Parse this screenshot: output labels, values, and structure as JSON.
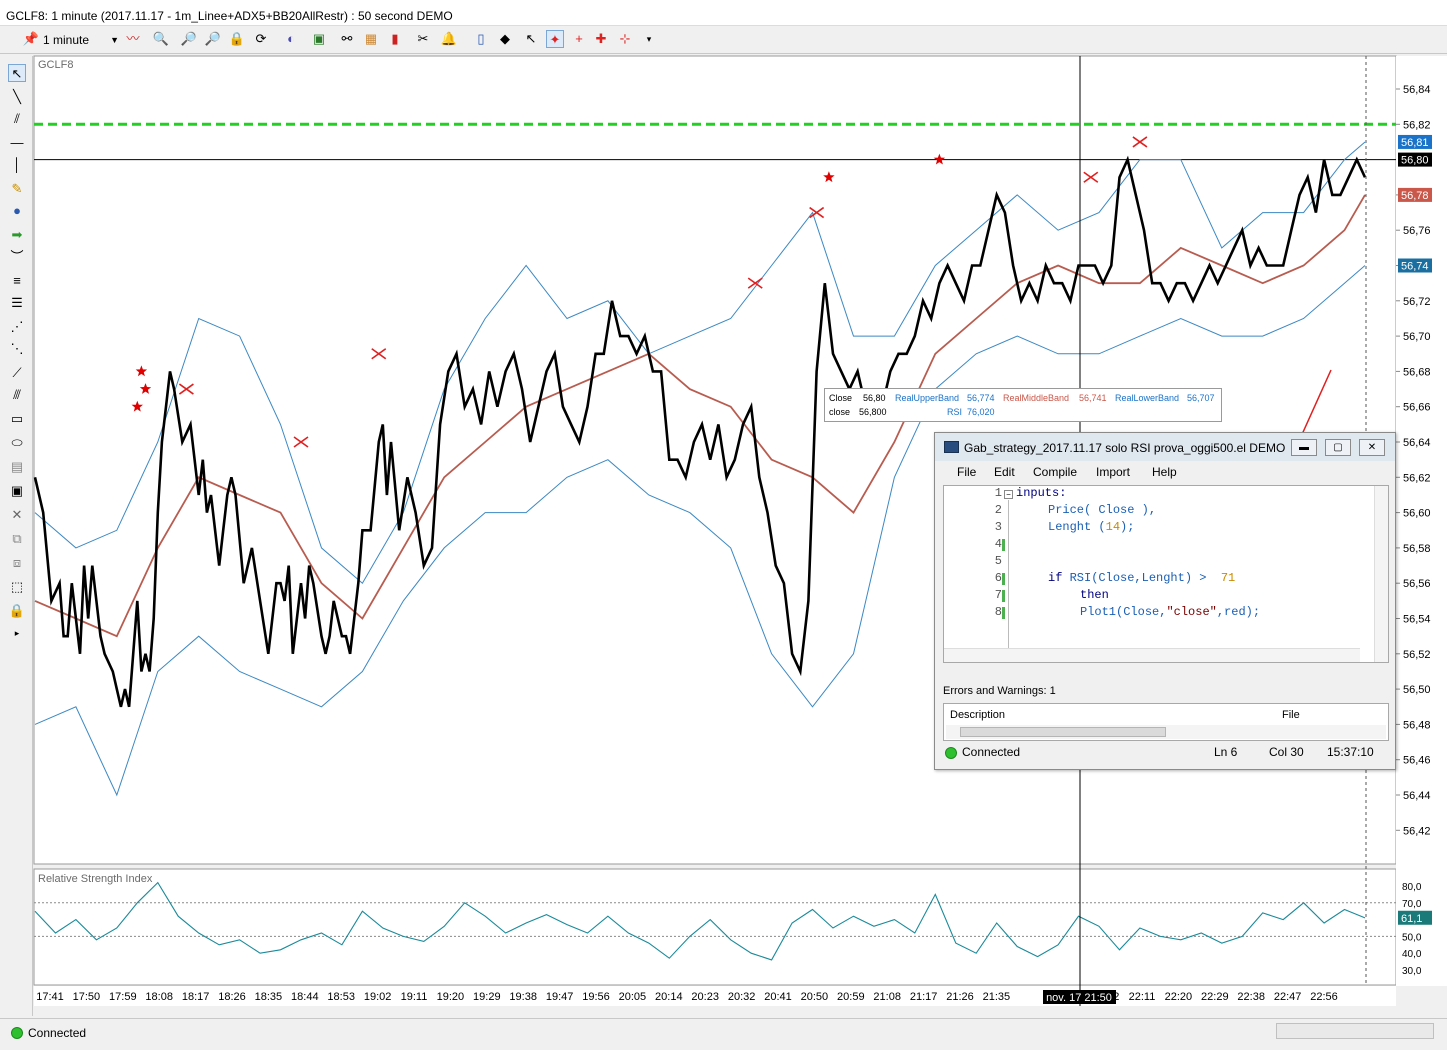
{
  "window": {
    "title": "GCLF8: 1 minute (2017.11.17 - 1m_Linee+ADX5+BB20AllRestr) : 50 second DEMO"
  },
  "toolbar": {
    "interval": "1 minute"
  },
  "chart_data": [
    {
      "type": "line",
      "title": "GCLF8",
      "x_unit": "minutes since 17:41 (10.38 minutes per time tick)",
      "xlim": [
        0,
        325
      ],
      "ylim": [
        56.4,
        56.86
      ],
      "yticks": [
        "56,84",
        "56,82",
        "56,78",
        "56,76",
        "56,74",
        "56,72",
        "56,70",
        "56,68",
        "56,66",
        "56,64",
        "56,62",
        "56,60",
        "56,58",
        "56,56",
        "56,54",
        "56,52",
        "56,50",
        "56,48",
        "56,46",
        "56,44",
        "56,42"
      ],
      "xtick_labels": [
        "17:41",
        "17:50",
        "17:59",
        "18:08",
        "18:17",
        "18:26",
        "18:35",
        "18:44",
        "18:53",
        "19:02",
        "19:11",
        "19:20",
        "19:29",
        "19:38",
        "19:47",
        "19:56",
        "20:05",
        "20:14",
        "20:23",
        "20:32",
        "20:41",
        "20:50",
        "20:59",
        "21:08",
        "21:17",
        "21:26",
        "21:35",
        "22:02",
        "22:11",
        "22:20",
        "22:29",
        "22:38",
        "22:47",
        "22:56"
      ],
      "crosshair_time_label": "nov. 17 21:50",
      "crosshair_price_label": "56,80",
      "price_badges": [
        {
          "value": "56,81",
          "color": "#1a73c9"
        },
        {
          "value": "56,80",
          "color": "#000000"
        },
        {
          "value": "56,78",
          "color": "#c9574a"
        },
        {
          "value": "56,74",
          "color": "#1a6fa0"
        }
      ],
      "hline_green": 56.82,
      "grid": false,
      "series": [
        {
          "name": "Close",
          "color": "#000000",
          "x": [
            0,
            2,
            4,
            6,
            7,
            8,
            9,
            11,
            12,
            13,
            14,
            16,
            17,
            19,
            20,
            21,
            22,
            23,
            24,
            25,
            26,
            27,
            28,
            29,
            30,
            31,
            32,
            33,
            34,
            36,
            38,
            39,
            40,
            41,
            42,
            43,
            44,
            45,
            46,
            47,
            48,
            49,
            51,
            53,
            55,
            57,
            59,
            60,
            61,
            62,
            63,
            65,
            66,
            67,
            68,
            70,
            71,
            72,
            73,
            74,
            75,
            76,
            77,
            78,
            79,
            80,
            82,
            84,
            85,
            86,
            87,
            89,
            91,
            93,
            95,
            97,
            99,
            101,
            103,
            105,
            107,
            109,
            111,
            113,
            115,
            117,
            119,
            121,
            123,
            125,
            127,
            129,
            131,
            133,
            135,
            137,
            139,
            141,
            143,
            145,
            147,
            149,
            151,
            153,
            155,
            157,
            159,
            161,
            163,
            165,
            167,
            169,
            171,
            173,
            175,
            177,
            179,
            181,
            183,
            185,
            187,
            189,
            191,
            193,
            195,
            197,
            199,
            201,
            203,
            205,
            207,
            209,
            211,
            213,
            215,
            217,
            219,
            221,
            223,
            225,
            227,
            229,
            231,
            233,
            235,
            237,
            239,
            241,
            243,
            245,
            247,
            249,
            251,
            253,
            255,
            257,
            259,
            261,
            263,
            265,
            267,
            269,
            271,
            273,
            275,
            277,
            279,
            281,
            283,
            285,
            287,
            289,
            291,
            293,
            295,
            297,
            299,
            301,
            303,
            305,
            307,
            309,
            311,
            313,
            315,
            317,
            319,
            321,
            323,
            325
          ],
          "y": [
            56.62,
            56.6,
            56.55,
            56.56,
            56.53,
            56.53,
            56.56,
            56.52,
            56.57,
            56.54,
            56.57,
            56.53,
            56.52,
            56.51,
            56.5,
            56.49,
            56.5,
            56.49,
            56.52,
            56.55,
            56.51,
            56.52,
            56.51,
            56.54,
            56.6,
            56.64,
            56.66,
            56.68,
            56.67,
            56.64,
            56.65,
            56.63,
            56.61,
            56.63,
            56.6,
            56.61,
            56.59,
            56.57,
            56.59,
            56.61,
            56.62,
            56.61,
            56.56,
            56.58,
            56.55,
            56.52,
            56.56,
            56.56,
            56.55,
            56.57,
            56.52,
            56.56,
            56.54,
            56.57,
            56.56,
            56.53,
            56.52,
            56.53,
            56.55,
            56.54,
            56.53,
            56.53,
            56.52,
            56.54,
            56.56,
            56.59,
            56.59,
            56.64,
            56.65,
            56.61,
            56.64,
            56.59,
            56.62,
            56.6,
            56.57,
            56.58,
            56.65,
            56.68,
            56.69,
            56.66,
            56.67,
            56.65,
            56.68,
            56.66,
            56.68,
            56.69,
            56.67,
            56.64,
            56.66,
            56.68,
            56.69,
            56.66,
            56.65,
            56.64,
            56.66,
            56.69,
            56.69,
            56.72,
            56.7,
            56.7,
            56.69,
            56.7,
            56.68,
            56.68,
            56.63,
            56.63,
            56.62,
            56.64,
            56.65,
            56.63,
            56.65,
            56.62,
            56.63,
            56.65,
            56.66,
            56.62,
            56.6,
            56.57,
            56.56,
            56.52,
            56.51,
            56.55,
            56.68,
            56.73,
            56.69,
            56.68,
            56.67,
            56.68,
            56.66,
            56.66,
            56.66,
            56.68,
            56.69,
            56.69,
            56.7,
            56.72,
            56.71,
            56.73,
            56.74,
            56.73,
            56.72,
            56.74,
            56.74,
            56.76,
            56.78,
            56.77,
            56.74,
            56.72,
            56.73,
            56.72,
            56.74,
            56.73,
            56.73,
            56.72,
            56.74,
            56.74,
            56.74,
            56.73,
            56.74,
            56.79,
            56.8,
            56.78,
            56.76,
            56.73,
            56.73,
            56.72,
            56.73,
            56.73,
            56.72,
            56.73,
            56.74,
            56.73,
            56.74,
            56.75,
            56.76,
            56.74,
            56.75,
            56.74,
            56.74,
            56.74,
            56.76,
            56.78,
            56.79,
            56.77,
            56.8,
            56.78,
            56.78,
            56.79,
            56.8,
            56.79
          ]
        },
        {
          "name": "RealUpperBand",
          "color": "#3b88c3",
          "x": [
            0,
            10,
            20,
            30,
            40,
            50,
            60,
            70,
            80,
            90,
            100,
            110,
            120,
            130,
            140,
            150,
            160,
            170,
            180,
            190,
            200,
            210,
            220,
            230,
            240,
            250,
            260,
            270,
            280,
            290,
            300,
            310,
            320,
            325
          ],
          "y": [
            56.6,
            56.58,
            56.59,
            56.64,
            56.71,
            56.7,
            56.65,
            56.58,
            56.56,
            56.6,
            56.67,
            56.71,
            56.74,
            56.71,
            56.72,
            56.69,
            56.7,
            56.71,
            56.74,
            56.77,
            56.7,
            56.7,
            56.74,
            56.76,
            56.78,
            56.76,
            56.77,
            56.8,
            56.8,
            56.75,
            56.77,
            56.77,
            56.8,
            56.81
          ]
        },
        {
          "name": "RealMiddleBand",
          "color": "#b85c50",
          "x": [
            0,
            10,
            20,
            30,
            40,
            50,
            60,
            70,
            80,
            90,
            100,
            110,
            120,
            130,
            140,
            150,
            160,
            170,
            180,
            190,
            200,
            210,
            220,
            230,
            240,
            250,
            260,
            270,
            280,
            290,
            300,
            310,
            320,
            325
          ],
          "y": [
            56.55,
            56.54,
            56.53,
            56.58,
            56.62,
            56.61,
            56.6,
            56.56,
            56.54,
            56.58,
            56.62,
            56.64,
            56.66,
            56.67,
            56.68,
            56.69,
            56.67,
            56.66,
            56.63,
            56.62,
            56.6,
            56.64,
            56.69,
            56.71,
            56.73,
            56.74,
            56.73,
            56.73,
            56.75,
            56.74,
            56.73,
            56.74,
            56.76,
            56.78
          ]
        },
        {
          "name": "RealLowerBand",
          "color": "#3b88c3",
          "x": [
            0,
            10,
            20,
            30,
            40,
            50,
            60,
            70,
            80,
            90,
            100,
            110,
            120,
            130,
            140,
            150,
            160,
            170,
            180,
            190,
            200,
            210,
            220,
            230,
            240,
            250,
            260,
            270,
            280,
            290,
            300,
            310,
            320,
            325
          ],
          "y": [
            56.48,
            56.49,
            56.44,
            56.51,
            56.53,
            56.51,
            56.5,
            56.49,
            56.51,
            56.55,
            56.58,
            56.6,
            56.6,
            56.62,
            56.63,
            56.61,
            56.6,
            56.58,
            56.52,
            56.49,
            56.52,
            56.62,
            56.67,
            56.69,
            56.7,
            56.69,
            56.69,
            56.7,
            56.71,
            56.7,
            56.7,
            56.71,
            56.73,
            56.74
          ]
        }
      ],
      "markers": {
        "red_x": [
          [
            37,
            56.67
          ],
          [
            65,
            56.64
          ],
          [
            84,
            56.69
          ],
          [
            176,
            56.73
          ],
          [
            191,
            56.77
          ],
          [
            258,
            56.79
          ],
          [
            270,
            56.81
          ]
        ],
        "red_star": [
          [
            25,
            56.66
          ],
          [
            26,
            56.68
          ],
          [
            27,
            56.67
          ],
          [
            194,
            56.79
          ],
          [
            221,
            56.8
          ]
        ]
      }
    },
    {
      "type": "line",
      "title": "Relative Strength Index",
      "ylim": [
        20,
        85
      ],
      "yticks": [
        "80,0",
        "70,0",
        "60,0",
        "50,0",
        "40,0",
        "30,0"
      ],
      "badge": {
        "value": "61,1",
        "color": "#1a7a7a"
      },
      "series": [
        {
          "name": "RSI",
          "color": "#1a8a9a",
          "x": [
            0,
            5,
            10,
            15,
            20,
            25,
            30,
            35,
            40,
            45,
            50,
            55,
            60,
            65,
            70,
            75,
            80,
            85,
            90,
            95,
            100,
            105,
            110,
            115,
            120,
            125,
            130,
            135,
            140,
            145,
            150,
            155,
            160,
            165,
            170,
            175,
            180,
            185,
            190,
            195,
            200,
            205,
            210,
            215,
            220,
            225,
            230,
            235,
            240,
            245,
            250,
            255,
            260,
            265,
            270,
            275,
            280,
            285,
            290,
            295,
            300,
            305,
            310,
            315,
            320,
            325
          ],
          "y": [
            65,
            52,
            60,
            48,
            55,
            70,
            82,
            62,
            52,
            45,
            48,
            40,
            42,
            48,
            52,
            45,
            65,
            55,
            50,
            47,
            56,
            70,
            62,
            52,
            58,
            63,
            57,
            52,
            62,
            52,
            46,
            37,
            50,
            60,
            48,
            40,
            36,
            58,
            66,
            55,
            62,
            56,
            60,
            52,
            75,
            46,
            40,
            58,
            44,
            38,
            45,
            62,
            56,
            42,
            55,
            50,
            48,
            52,
            46,
            50,
            64,
            60,
            70,
            58,
            66,
            61
          ]
        }
      ]
    }
  ],
  "tooltip": {
    "close_label": "Close",
    "close_value": "56,80",
    "upper_label": "RealUpperBand",
    "upper_value": "56,774",
    "middle_label": "RealMiddleBand",
    "middle_value": "56,741",
    "lower_label": "RealLowerBand",
    "lower_value": "56,707",
    "plot_label": "close",
    "plot_value": "56,800",
    "rsi_label": "RSI",
    "rsi_value": "76,020"
  },
  "editor": {
    "title": "Gab_strategy_2017.11.17 solo RSI prova_oggi500.el DEMO",
    "menu": [
      "File",
      "Edit",
      "Compile",
      "Import",
      "Help"
    ],
    "line_numbers": [
      "1",
      "2",
      "3",
      "4",
      "5",
      "6",
      "7",
      "8"
    ],
    "code": {
      "l1_kw": "inputs:",
      "l2_fn": "Price",
      "l2_rest": "( Close ),",
      "l3_fn": "Lenght",
      "l3_a": " (",
      "l3_num": "14",
      "l3_b": ");",
      "l6_kw": "if",
      "l6_fn": "RSI",
      "l6_rest": "(Close,Lenght) >",
      "l6_num": "71",
      "l7_kw": "then",
      "l8_fn": "Plot1",
      "l8_a": "(Close,",
      "l8_str": "\"close\"",
      "l8_b": ",red);"
    },
    "errors_label": "Errors and Warnings: 1",
    "col_description": "Description",
    "col_file": "File",
    "status_connected": "Connected",
    "status_ln": "Ln  6",
    "status_col": "Col  30",
    "status_time": "15:37:10"
  },
  "status": {
    "connected": "Connected"
  }
}
